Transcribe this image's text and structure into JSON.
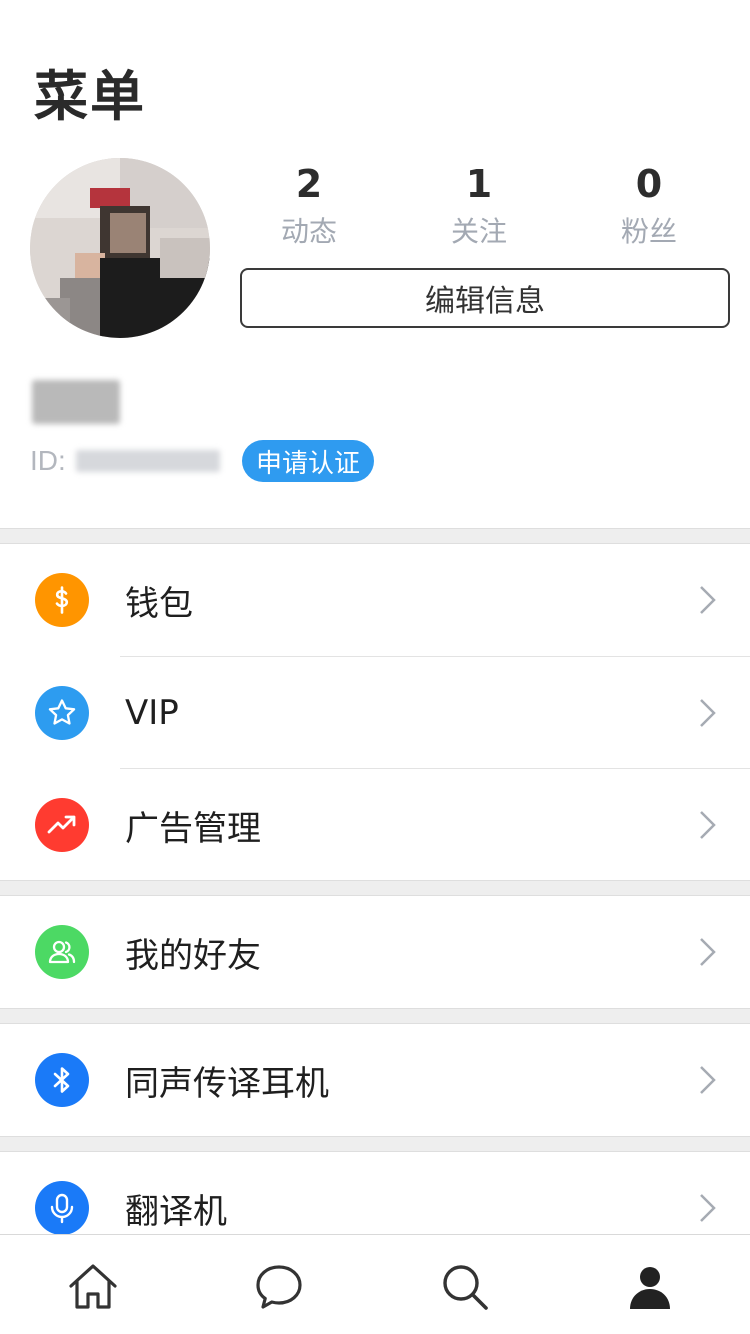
{
  "header": {
    "title": "菜单"
  },
  "profile": {
    "stats": [
      {
        "value": "2",
        "label": "动态"
      },
      {
        "value": "1",
        "label": "关注"
      },
      {
        "value": "0",
        "label": "粉丝"
      }
    ],
    "edit_label": "编辑信息",
    "id_label": "ID:",
    "verify_label": "申请认证"
  },
  "menu": {
    "items": [
      {
        "label": "钱包",
        "icon": "dollar-icon",
        "color": "#ff9500"
      },
      {
        "label": "VIP",
        "icon": "star-icon",
        "color": "#2d9cf0"
      },
      {
        "label": "广告管理",
        "icon": "trending-up-icon",
        "color": "#ff3b30"
      },
      {
        "label": "我的好友",
        "icon": "friends-icon",
        "color": "#4cd964"
      },
      {
        "label": "同声传译耳机",
        "icon": "bluetooth-icon",
        "color": "#1a7af8"
      },
      {
        "label": "翻译机",
        "icon": "microphone-icon",
        "color": "#1a7af8"
      }
    ]
  },
  "tabbar": {
    "tabs": [
      {
        "icon": "home-icon"
      },
      {
        "icon": "chat-icon"
      },
      {
        "icon": "search-icon"
      },
      {
        "icon": "profile-icon"
      }
    ]
  }
}
